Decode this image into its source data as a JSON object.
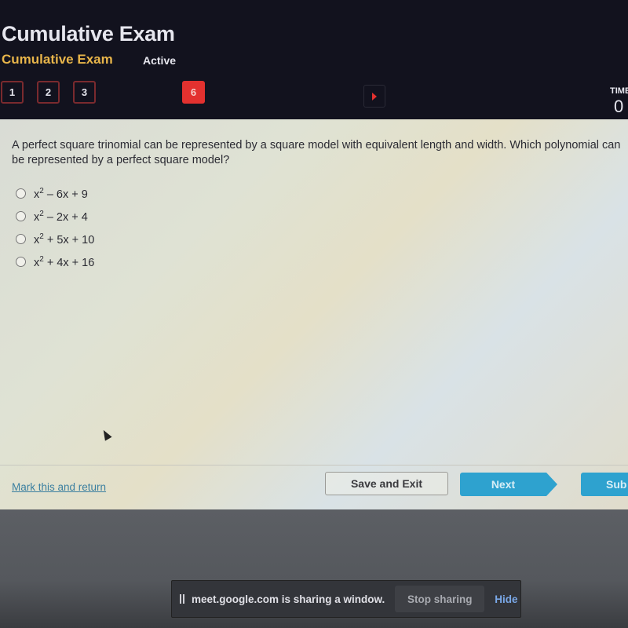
{
  "header": {
    "title": "Cumulative Exam",
    "subtitle": "Cumulative Exam",
    "status": "Active",
    "question_nav": [
      "1",
      "2",
      "3",
      "6"
    ],
    "active_question": "6",
    "timer_label": "TIME",
    "timer_value": "0"
  },
  "question": {
    "text": "A perfect square trinomial can be represented by a square model with equivalent length and width. Which polynomial can be represented by a perfect square model?",
    "options": [
      {
        "base": "x",
        "exp": "2",
        "rest": " – 6x + 9"
      },
      {
        "base": "x",
        "exp": "2",
        "rest": " – 2x + 4"
      },
      {
        "base": "x",
        "exp": "2",
        "rest": " + 5x + 10"
      },
      {
        "base": "x",
        "exp": "2",
        "rest": " + 4x + 16"
      }
    ]
  },
  "footer": {
    "mark_link": "Mark this and return",
    "save_label": "Save and Exit",
    "next_label": "Next",
    "submit_label": "Sub"
  },
  "share_bar": {
    "message": "meet.google.com is sharing a window.",
    "stop_label": "Stop sharing",
    "hide_label": "Hide"
  },
  "colors": {
    "accent_red": "#e3312f",
    "accent_blue": "#2ea2cf",
    "subtitle_gold": "#e8b54a"
  }
}
